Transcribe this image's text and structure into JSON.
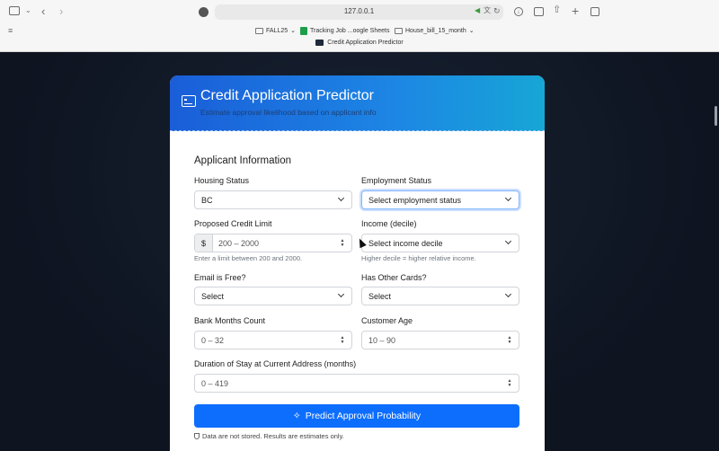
{
  "browser": {
    "url": "127.0.0.1",
    "tab_title": "Credit Application Predictor",
    "bookmarks": [
      {
        "label": "FALL25",
        "icon": "folder-icon"
      },
      {
        "label": "Tracking Job ...oogle Sheets",
        "icon": "sheets-icon"
      },
      {
        "label": "House_bill_15_month",
        "icon": "folder-icon"
      }
    ]
  },
  "header": {
    "title": "Credit Application Predictor",
    "subtitle": "Estimate approval likelihood based on applicant info"
  },
  "form": {
    "section_title": "Applicant Information",
    "housing": {
      "label": "Housing Status",
      "value": "BC"
    },
    "employment": {
      "label": "Employment Status",
      "value": "Select employment status"
    },
    "credit_limit": {
      "label": "Proposed Credit Limit",
      "prefix": "$",
      "placeholder": "200 – 2000",
      "help": "Enter a limit between 200 and 2000."
    },
    "income": {
      "label": "Income (decile)",
      "value": "Select income decile",
      "help": "Higher decile = higher relative income."
    },
    "email_free": {
      "label": "Email is Free?",
      "value": "Select"
    },
    "other_cards": {
      "label": "Has Other Cards?",
      "value": "Select"
    },
    "bank_months": {
      "label": "Bank Months Count",
      "placeholder": "0 – 32"
    },
    "age": {
      "label": "Customer Age",
      "placeholder": "10 – 90"
    },
    "duration": {
      "label": "Duration of Stay at Current Address (months)",
      "placeholder": "0 – 419"
    },
    "submit_label": "Predict Approval Probability",
    "note": "Data are not stored. Results are estimates only."
  },
  "colors": {
    "accent": "#0d6efd",
    "header_start": "#1a5ed8",
    "header_end": "#17a6d6",
    "background": "#0f1524"
  }
}
